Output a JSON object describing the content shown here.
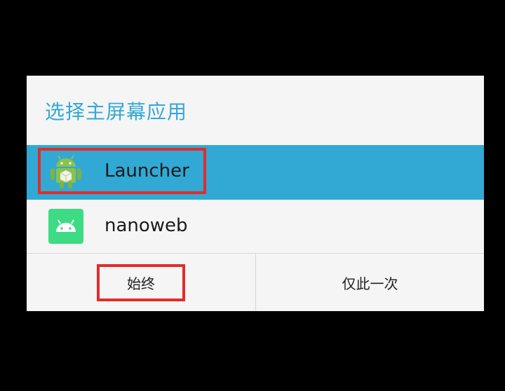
{
  "dialog": {
    "title": "选择主屏幕应用",
    "apps": [
      {
        "label": "Launcher",
        "icon": "android-launcher-icon",
        "selected": true,
        "highlight_color": "#31a9d4"
      },
      {
        "label": "nanoweb",
        "icon": "android-app-icon",
        "selected": false
      }
    ],
    "buttons": {
      "always_label": "始终",
      "once_label": "仅此一次"
    },
    "colors": {
      "title": "#33a8d6",
      "selection": "#31a9d4",
      "annotation": "#e32b2b"
    }
  }
}
